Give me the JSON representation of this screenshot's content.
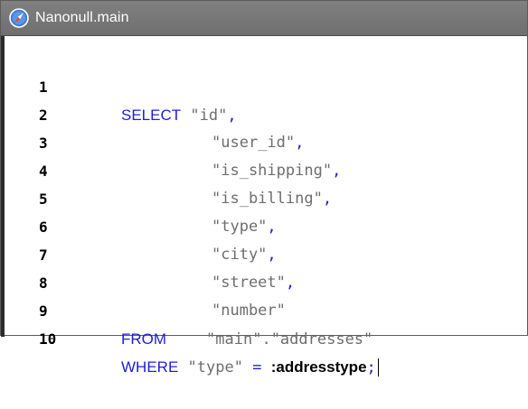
{
  "window": {
    "title": "Nanonull.main",
    "icon": "compass-icon"
  },
  "editor": {
    "lines": [
      {
        "number": "1",
        "keyword": "SELECT",
        "text": "\"id\"",
        "suffix": ","
      },
      {
        "number": "2",
        "keyword": "",
        "text": "\"user_id\"",
        "suffix": ","
      },
      {
        "number": "3",
        "keyword": "",
        "text": "\"is_shipping\"",
        "suffix": ","
      },
      {
        "number": "4",
        "keyword": "",
        "text": "\"is_billing\"",
        "suffix": ","
      },
      {
        "number": "5",
        "keyword": "",
        "text": "\"type\"",
        "suffix": ","
      },
      {
        "number": "6",
        "keyword": "",
        "text": "\"city\"",
        "suffix": ","
      },
      {
        "number": "7",
        "keyword": "",
        "text": "\"street\"",
        "suffix": ","
      },
      {
        "number": "8",
        "keyword": "",
        "text": "\"number\"",
        "suffix": ""
      },
      {
        "number": "9",
        "keyword": "FROM",
        "text": "\"main\".\"addresses\"",
        "suffix": ""
      },
      {
        "number": "10",
        "keyword": "WHERE",
        "text": "\"type\"",
        "operator": "=",
        "param": ":addresstype",
        "suffix": ";"
      }
    ]
  }
}
